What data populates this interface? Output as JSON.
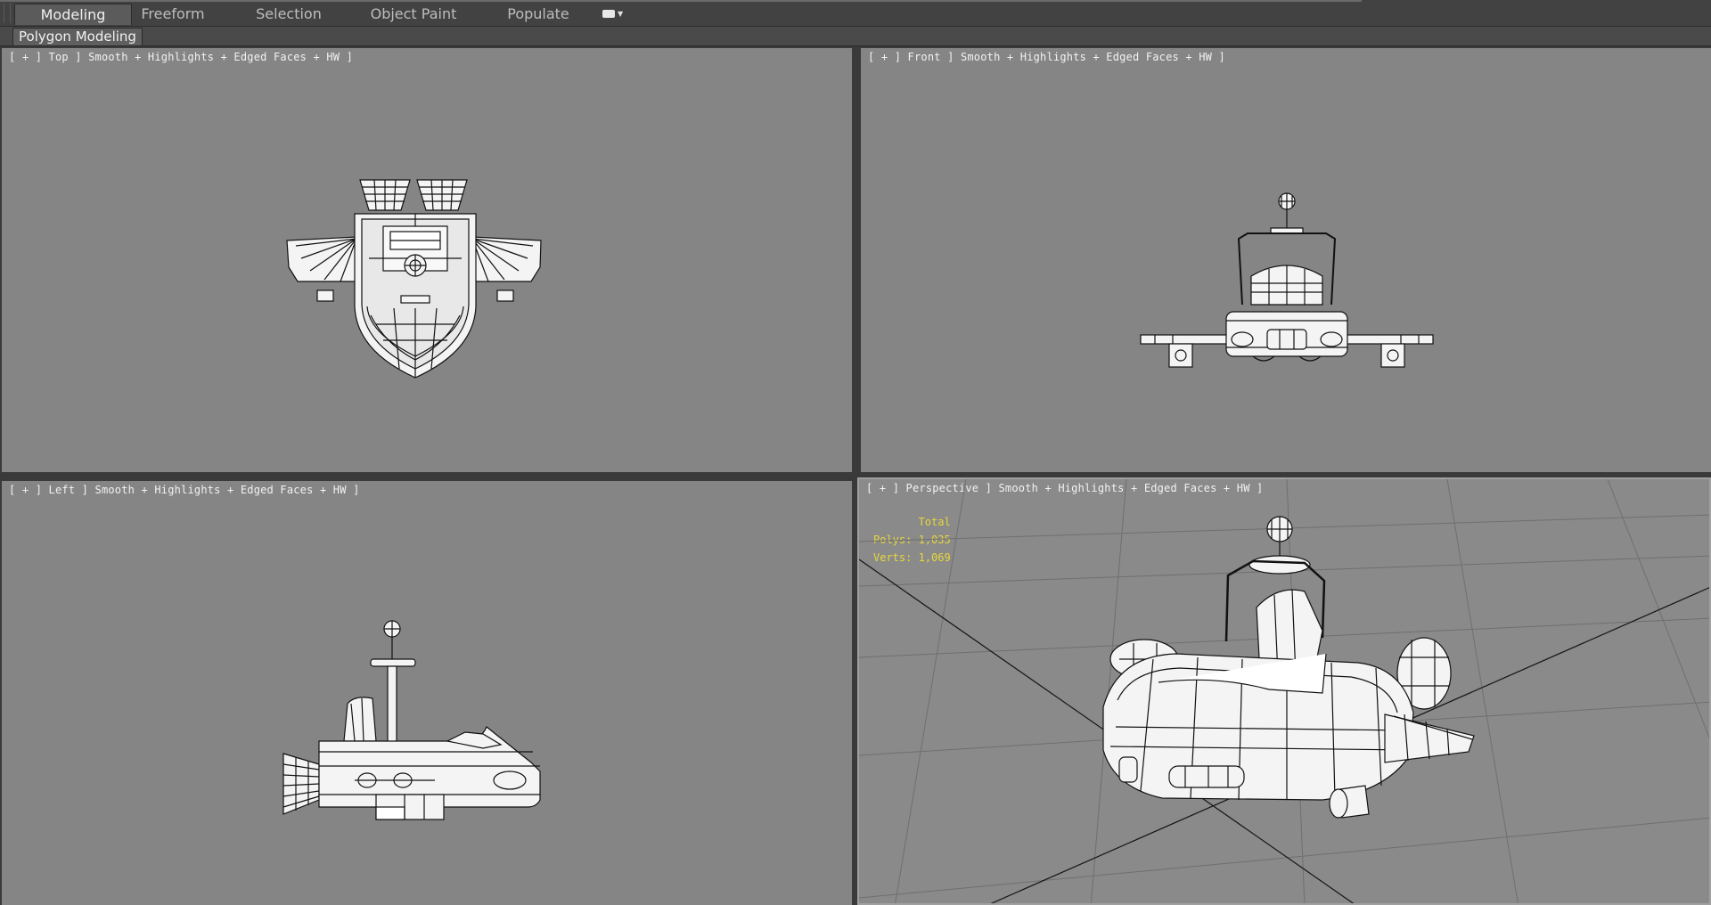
{
  "ribbon": {
    "tabs": [
      {
        "label": "Modeling",
        "active": true
      },
      {
        "label": "Freeform",
        "active": false
      },
      {
        "label": "Selection",
        "active": false
      },
      {
        "label": "Object Paint",
        "active": false
      },
      {
        "label": "Populate",
        "active": false
      }
    ],
    "options_icon": "ribbon-options-icon",
    "panel_title": "Polygon Modeling"
  },
  "viewports": {
    "top": {
      "label": "[ + ] Top ] Smooth + Highlights + Edged Faces + HW ]"
    },
    "front": {
      "label": "[ + ] Front ] Smooth + Highlights + Edged Faces + HW ]"
    },
    "left": {
      "label": "[ + ] Left ] Smooth + Highlights + Edged Faces + HW ]"
    },
    "perspective": {
      "label": "[ + ] Perspective ] Smooth + Highlights + Edged Faces + HW ]"
    }
  },
  "stats": {
    "title": "Total",
    "polys_label": "Polys:",
    "polys_value": "1,035",
    "verts_label": "Verts:",
    "verts_value": "1,069"
  },
  "colors": {
    "viewport_bg": "#858585",
    "frame_bg": "#3a3a3a",
    "stats_text": "#e8d73a",
    "wire": "#111111",
    "surface": "#f4f4f4"
  }
}
